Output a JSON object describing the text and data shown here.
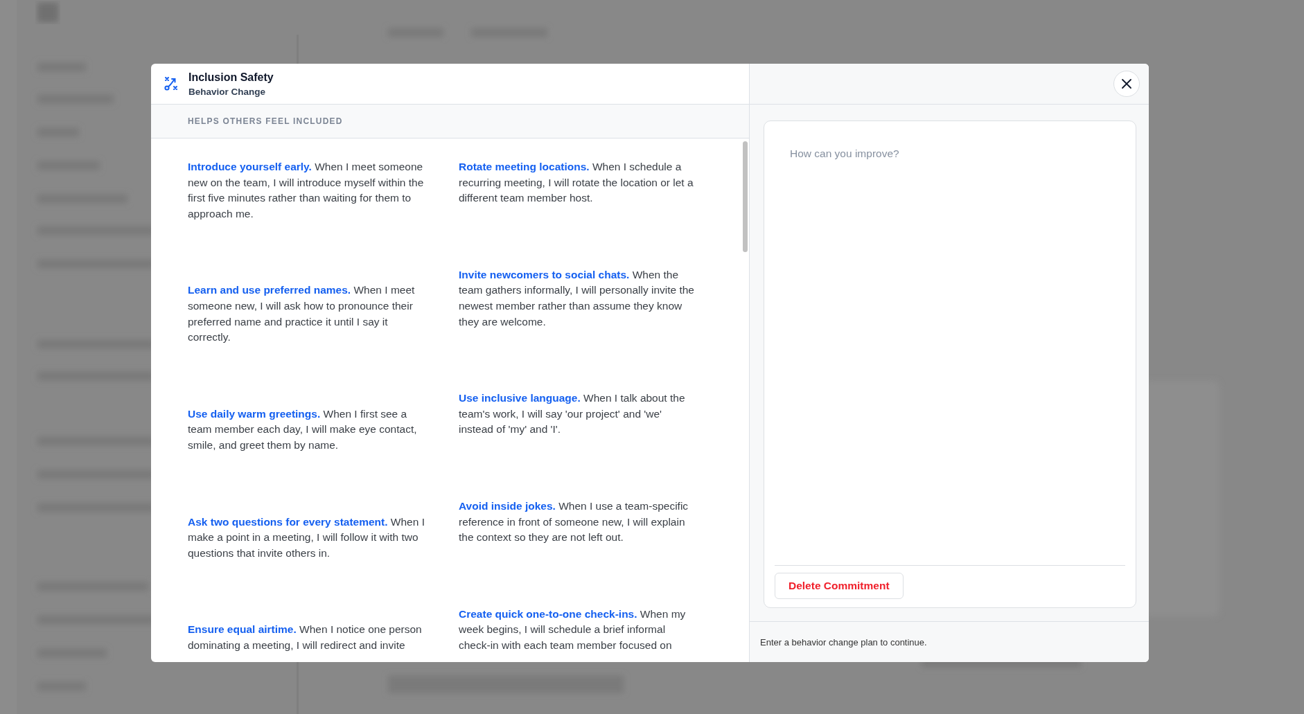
{
  "modal": {
    "title": "Inclusion Safety",
    "subtitle": "Behavior Change",
    "section_label": "HELPS OTHERS FEEL INCLUDED",
    "columns": [
      {
        "items": [
          {
            "title": "Introduce yourself early.",
            "text": "When I meet someone new on the team, I will introduce myself within the first five minutes rather than waiting for them to approach me."
          },
          {
            "title": "Learn and use preferred names.",
            "text": "When I meet someone new, I will ask how to pronounce their preferred name and practice it until I say it correctly."
          },
          {
            "title": "Use daily warm greetings.",
            "text": "When I first see a team member each day, I will make eye contact, smile, and greet them by name."
          },
          {
            "title": "Ask two questions for every statement.",
            "text": "When I make a point in a meeting, I will follow it with two questions that invite others in."
          },
          {
            "title": "Ensure equal airtime.",
            "text": "When I notice one person dominating a meeting, I will redirect and invite"
          }
        ]
      },
      {
        "items": [
          {
            "title": "Rotate meeting locations.",
            "text": "When I schedule a recurring meeting, I will rotate the location or let a different team member host."
          },
          {
            "title": "Invite newcomers to social chats.",
            "text": "When the team gathers informally, I will personally invite the newest member rather than assume they know they are welcome."
          },
          {
            "title": "Use inclusive language.",
            "text": "When I talk about the team's work, I will say 'our project' and 'we' instead of 'my' and 'I'."
          },
          {
            "title": "Avoid inside jokes.",
            "text": "When I use a team-specific reference in front of someone new, I will explain the context so they are not left out."
          },
          {
            "title": "Create quick one-to-one check-ins.",
            "text": "When my week begins, I will schedule a brief informal check-in with each team member focused on"
          }
        ]
      }
    ],
    "plan_field": {
      "placeholder": "How can you improve?"
    },
    "delete_button": "Delete Commitment",
    "footer_note": "Enter a behavior change plan to continue."
  }
}
